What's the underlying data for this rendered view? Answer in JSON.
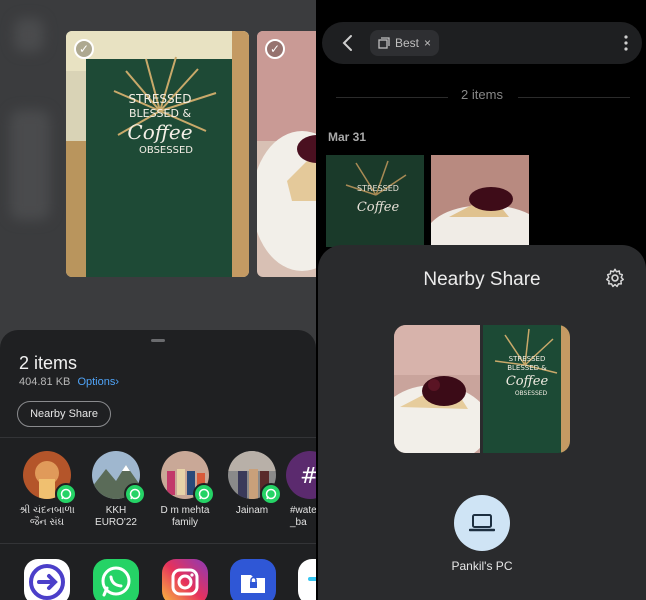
{
  "left": {
    "share_sheet": {
      "title": "2 items",
      "size": "404.81 KB",
      "options_label": "Options",
      "options_chevron": "›",
      "nearby_share_button": "Nearby Share"
    },
    "contacts": [
      {
        "label_line1": "શ્રી ચંદનબાળા",
        "label_line2": "જૈન સંઘ"
      },
      {
        "label_line1": "KKH",
        "label_line2": "EURO'22"
      },
      {
        "label_line1": "D m mehta",
        "label_line2": "family"
      },
      {
        "label_line1": "Jainam",
        "label_line2": ""
      },
      {
        "label_line1": "#wate",
        "label_line2": "_ba"
      }
    ],
    "apps": [
      "share-to-device",
      "whatsapp",
      "instagram",
      "secure-folder",
      "slack"
    ],
    "thumb_sign_text": [
      "STRESSED",
      "BLESSED &",
      "Coffee",
      "OBSESSED"
    ]
  },
  "right": {
    "search_chip": {
      "label": "Best",
      "close": "×"
    },
    "count_text": "2 items",
    "date_label": "Mar 31",
    "nearby_share": {
      "title": "Nearby Share",
      "device_name": "Pankil's PC"
    }
  },
  "colors": {
    "accent_blue": "#4fa3f7",
    "whatsapp_green": "#25d366",
    "sheet_bg": "#1f2022",
    "nearby_bg": "#2a2b2d"
  }
}
